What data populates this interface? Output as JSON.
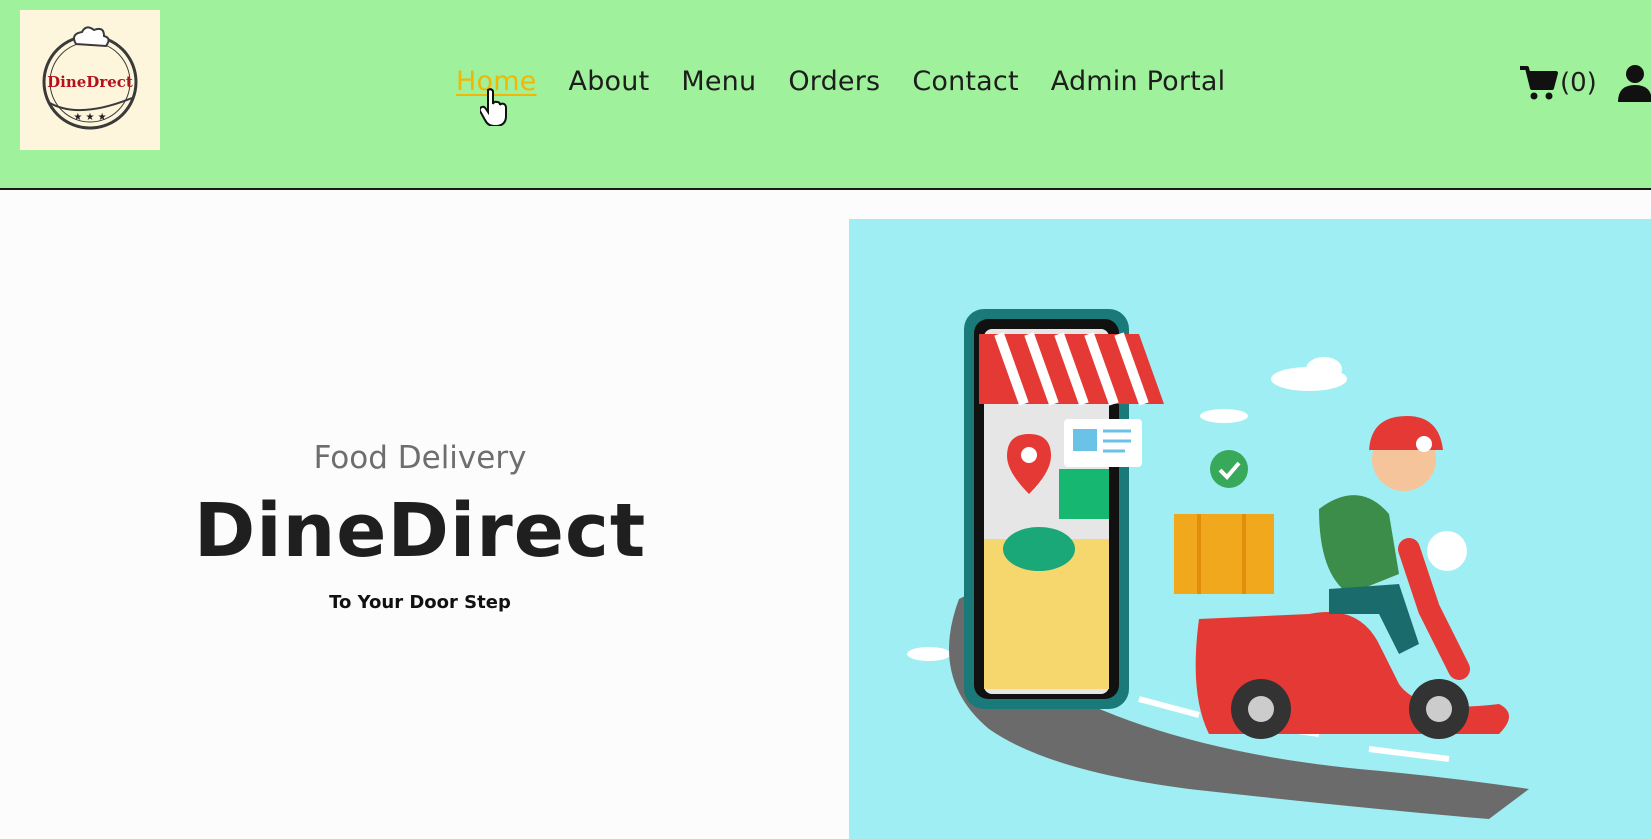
{
  "header": {
    "logo_text": "DineDrect",
    "nav": [
      {
        "label": "Home",
        "active": true
      },
      {
        "label": "About"
      },
      {
        "label": "Menu"
      },
      {
        "label": "Orders"
      },
      {
        "label": "Contact"
      },
      {
        "label": "Admin Portal"
      }
    ],
    "cart_count": "(0)",
    "icons": {
      "cart": "cart-icon",
      "user": "user-icon"
    },
    "bg_color": "#9ff19c",
    "active_color": "#f2b705"
  },
  "hero": {
    "subtitle": "Food Delivery",
    "title": "DineDirect",
    "tagline": "To Your Door Step"
  },
  "illustration": {
    "bg_color": "#9eeef3"
  }
}
